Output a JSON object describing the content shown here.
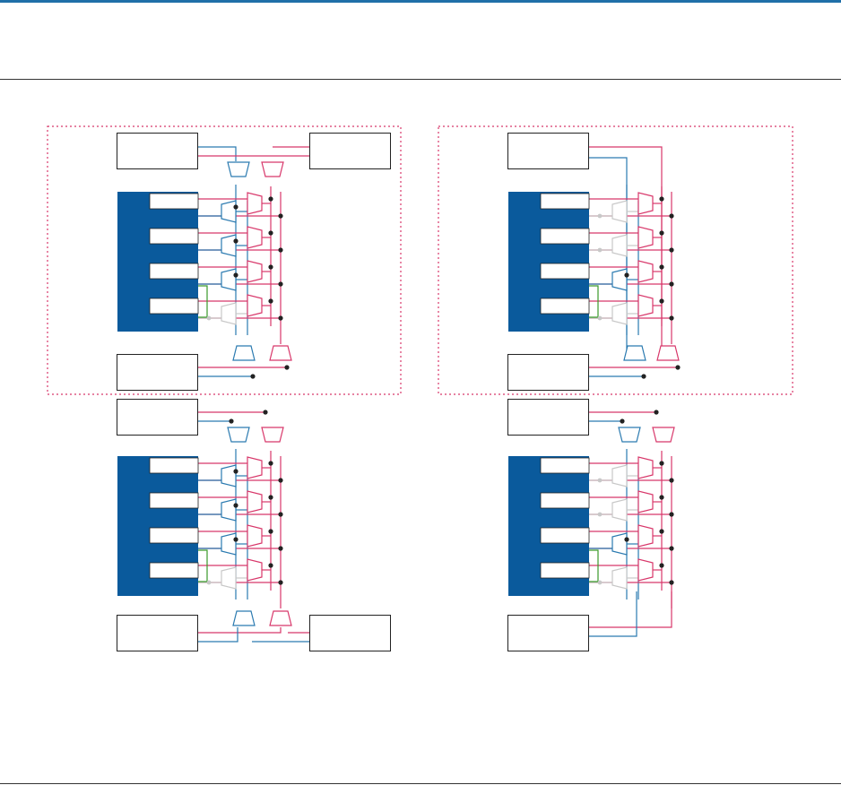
{
  "colors": {
    "brand_bar": "#1f6fa8",
    "cell_fill": "#0a5a9c",
    "blue_route": "#2a7ab0",
    "red_route": "#d8376a",
    "green_link": "#3a9a2a",
    "gray_unused": "#c8c8c8",
    "junction": "#222222",
    "cluster_border": "#d8376a"
  },
  "icons": {
    "mux": "trapezoid-mux-icon",
    "junction": "junction-dot-icon"
  },
  "diagram": {
    "panels": [
      {
        "name": "left-routing-panel",
        "active_blue_muxes_per_stack": 3
      },
      {
        "name": "right-routing-panel",
        "active_blue_muxes_per_stack": 1
      }
    ]
  }
}
